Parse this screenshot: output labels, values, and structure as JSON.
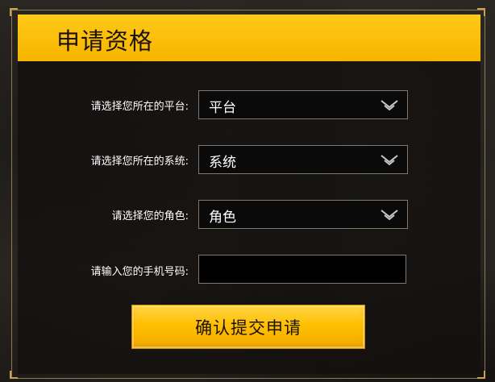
{
  "header": {
    "title": "申请资格"
  },
  "form": {
    "platform": {
      "label": "请选择您所在的平台:",
      "value": "平台"
    },
    "system": {
      "label": "请选择您所在的系统:",
      "value": "系统"
    },
    "role": {
      "label": "请选择您的角色:",
      "value": "角色"
    },
    "phone": {
      "label": "请输入您的手机号码:",
      "value": "",
      "placeholder": ""
    },
    "submit_label": "确认提交申请"
  },
  "colors": {
    "accent": "#ffc000",
    "header": "#ffc818",
    "input_border": "#7e7a72",
    "text": "#ffffff"
  },
  "icons": {
    "dropdown": "chevron-down-icon"
  }
}
